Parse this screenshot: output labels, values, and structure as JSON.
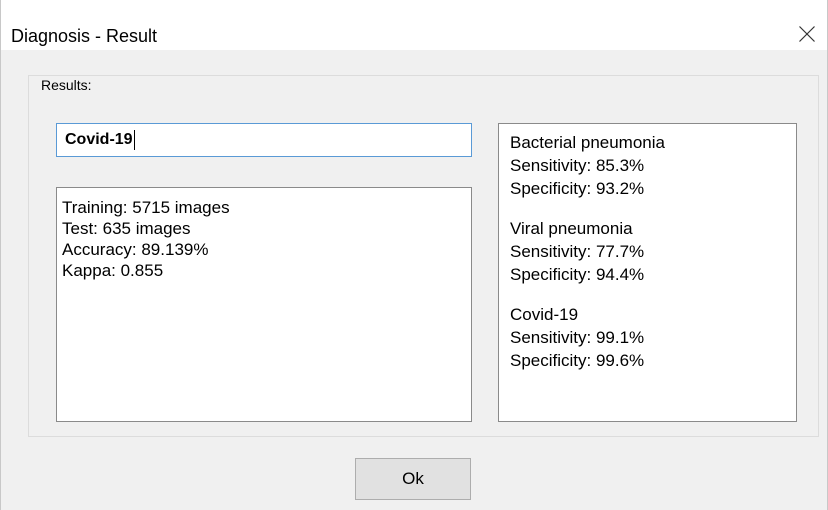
{
  "window": {
    "title": "Diagnosis - Result"
  },
  "results": {
    "group_label": "Results:",
    "selected_class": "Covid-19",
    "info_lines": [
      "Training: 5715 images",
      "Test: 635 images",
      "Accuracy: 89.139%",
      "Kappa: 0.855"
    ],
    "class_stats": [
      {
        "name": "Bacterial pneumonia",
        "sensitivity": "Sensitivity: 85.3%",
        "specificity": "Specificity: 93.2%"
      },
      {
        "name": "Viral pneumonia",
        "sensitivity": "Sensitivity: 77.7%",
        "specificity": "Specificity: 94.4%"
      },
      {
        "name": "Covid-19",
        "sensitivity": "Sensitivity: 99.1%",
        "specificity": "Specificity: 99.6%"
      }
    ]
  },
  "buttons": {
    "ok_label": "Ok"
  },
  "icons": {
    "close": "close-icon"
  }
}
